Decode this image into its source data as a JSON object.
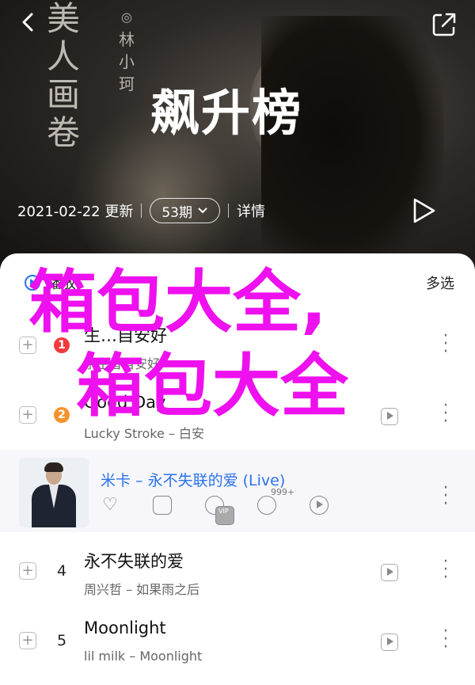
{
  "hero": {
    "calligraphy": "美人画卷",
    "author_mark": "◎",
    "author": "林小珂",
    "title": "飙升榜",
    "date": "2021-02-22 更新",
    "count": "53期",
    "detail": "详情"
  },
  "list": {
    "header": "播放",
    "multi_select": "多选"
  },
  "rows": [
    {
      "rank": "1",
      "title": "生…自安好",
      "sub": "余生皆自安好",
      "badge_color": "#f03c3c"
    },
    {
      "rank": "2",
      "title": "Good Day",
      "sub": "Lucky Stroke – 白安",
      "badge_color": "#f5932b"
    },
    {
      "rank": "4",
      "title": "永不失联的爱",
      "sub": "周兴哲 – 如果雨之后"
    },
    {
      "rank": "5",
      "title": "Moonlight",
      "sub": "lil milk – Moonlight"
    }
  ],
  "featured": {
    "title": "米卡 – 永不失联的爱 (Live)",
    "comment_count": "999+",
    "vip": "VIP"
  },
  "overlay": {
    "line1": "箱包大全,",
    "line2": "箱包大全"
  },
  "colors": {
    "accent": "#2b73e8",
    "overlay": "#ee10ee"
  }
}
